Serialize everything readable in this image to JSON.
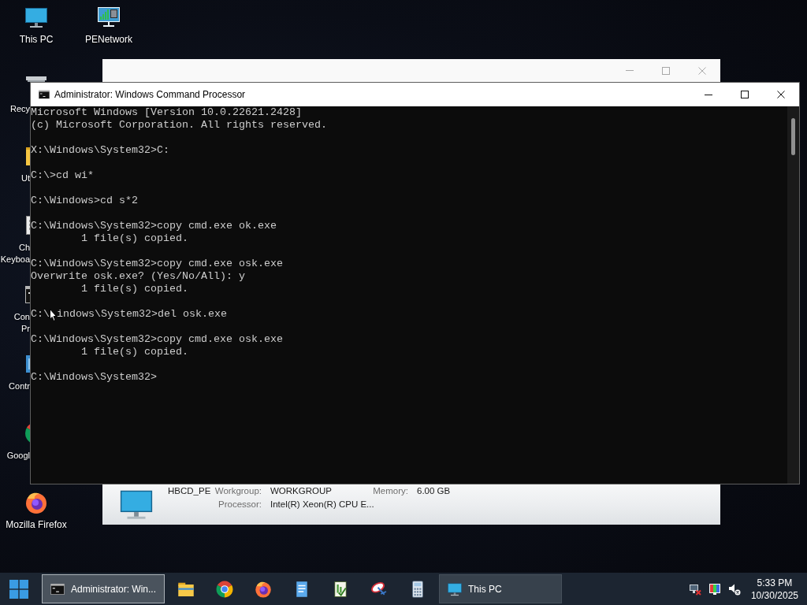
{
  "desktop": {
    "columns": [
      [
        {
          "kind": "computer",
          "lines": [
            "This PC"
          ]
        },
        {
          "kind": "bin",
          "lines": [
            "Recy"
          ]
        },
        {
          "kind": "folder",
          "lines": [
            "Ut"
          ]
        },
        {
          "kind": "keyboard",
          "lines": [
            "Ch",
            "Keyboa"
          ]
        },
        {
          "kind": "console",
          "lines": [
            "Con",
            "Pr"
          ]
        },
        {
          "kind": "control_panel",
          "lines": [
            "Contr"
          ]
        },
        {
          "kind": "chrome",
          "lines": [
            "Googl"
          ]
        },
        {
          "kind": "firefox",
          "lines": [
            "Mozilla Firefox"
          ]
        }
      ],
      [
        {
          "kind": "network",
          "lines": [
            "PENetwork"
          ]
        }
      ]
    ]
  },
  "explorer_window": {
    "details": {
      "computer_name": "HBCD_PE",
      "properties": [
        {
          "label": "Workgroup:",
          "value": "WORKGROUP"
        },
        {
          "label": "Memory:",
          "value": "6.00 GB"
        },
        {
          "label": "Processor:",
          "value": "Intel(R) Xeon(R) CPU E..."
        }
      ]
    }
  },
  "console_window": {
    "title": "Administrator: Windows Command Processor",
    "blocks": [
      {
        "lines": [
          {
            "segments": [
              "Microsoft Windows [Version 10.0.22621.2428]"
            ],
            "indented": false
          },
          {
            "segments": [
              "(c) Microsoft Corporation. All rights reserved."
            ],
            "indented": false
          }
        ]
      },
      {
        "lines": [
          {
            "segments": [
              "X:\\Windows\\System32>C:"
            ],
            "indented": false
          }
        ]
      },
      {
        "lines": [
          {
            "segments": [
              "C:\\>cd wi*"
            ],
            "indented": false
          }
        ]
      },
      {
        "lines": [
          {
            "segments": [
              "C:\\Windows>cd s*2"
            ],
            "indented": false
          }
        ]
      },
      {
        "lines": [
          {
            "segments": [
              "C:\\Windows\\System32>copy cmd.exe ok.exe"
            ],
            "indented": false
          },
          {
            "segments": [
              "1 file(s) copied."
            ],
            "indented": true
          }
        ]
      },
      {
        "lines": [
          {
            "segments": [
              "C:\\Windows\\System32>copy cmd.exe osk.exe"
            ],
            "indented": false
          },
          {
            "segments": [
              "Overwrite osk.exe? (Yes/No/All): y"
            ],
            "indented": false
          },
          {
            "segments": [
              "1 file(s) copied."
            ],
            "indented": true
          }
        ]
      },
      {
        "lines": [
          {
            "segments": [
              "C:\\",
              "indows\\System32>del osk.exe"
            ],
            "indented": false
          }
        ]
      },
      {
        "lines": [
          {
            "segments": [
              "C:\\Windows\\System32>copy cmd.exe osk.exe"
            ],
            "indented": false
          },
          {
            "segments": [
              "1 file(s) copied."
            ],
            "indented": true
          }
        ]
      },
      {
        "lines": [
          {
            "segments": [
              "C:\\Windows\\System32>"
            ],
            "indented": false
          }
        ]
      }
    ]
  },
  "taskbar": {
    "items": [
      {
        "kind": "console_window",
        "label": "Administrator: Win...",
        "selected": true
      },
      {
        "kind": "explorer"
      },
      {
        "kind": "chrome"
      },
      {
        "kind": "firefox"
      },
      {
        "kind": "notepad"
      },
      {
        "kind": "editor"
      },
      {
        "kind": "dish"
      },
      {
        "kind": "calculator"
      },
      {
        "kind": "computer_window",
        "label": "This PC",
        "selected": false
      }
    ],
    "clock": {
      "time": "5:33 PM",
      "date": "10/30/2025"
    }
  }
}
